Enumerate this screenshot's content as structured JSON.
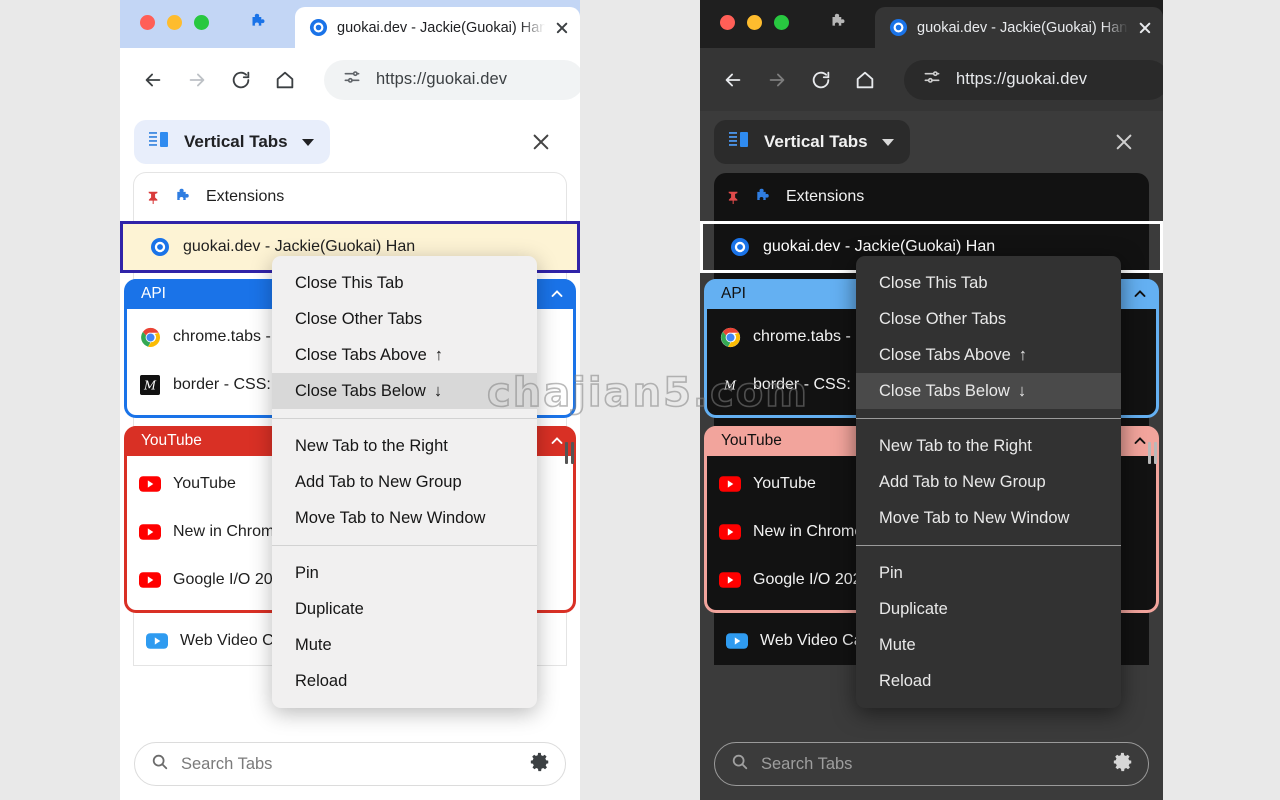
{
  "watermark": "chajian5.com",
  "browser": {
    "tab_title": "guokai.dev - Jackie(Guokai) Han",
    "url": "https://guokai.dev",
    "favicon": "guokai-favicon",
    "traffic_lights": [
      "close-red",
      "minimize-yellow",
      "maximize-green"
    ],
    "nav": {
      "back": "back-arrow-icon",
      "forward": "forward-arrow-icon",
      "reload": "reload-icon",
      "home": "home-icon",
      "site_settings": "site-settings-icon"
    },
    "extension_icon": "puzzle-piece-icon",
    "tab_close": "close-icon"
  },
  "panel": {
    "title": "Vertical Tabs",
    "title_icon": "vertical-tabs-icon",
    "dropdown_icon": "chevron-down-icon",
    "close_icon": "close-icon",
    "pinned_row": {
      "pin_icon": "pin-icon",
      "favicon": "puzzle-piece-icon",
      "label": "Extensions"
    },
    "selected_row": {
      "favicon": "guokai-favicon",
      "label": "guokai.dev - Jackie(Guokai) Han"
    },
    "groups": [
      {
        "name": "API",
        "color": "#1a73e8",
        "color_dark": "#64b0f2",
        "collapse_icon": "chevron-up-icon",
        "tabs": [
          {
            "favicon": "chrome-icon",
            "label": "chrome.tabs - Chrome Developers"
          },
          {
            "favicon": "mdn-icon",
            "label": "border - CSS: Cascading Style Sheets"
          }
        ]
      },
      {
        "name": "YouTube",
        "color": "#d93025",
        "color_dark": "#f2a49c",
        "collapse_icon": "chevron-up-icon",
        "tabs": [
          {
            "favicon": "youtube-icon",
            "label": "YouTube"
          },
          {
            "favicon": "youtube-icon",
            "label": "New in Chrome 114"
          },
          {
            "favicon": "youtube-icon",
            "label": "Google I/O 2023"
          }
        ]
      }
    ],
    "ungrouped": [
      {
        "favicon": "web-video-icon",
        "label": "Web Video Caster"
      }
    ],
    "search": {
      "placeholder": "Search Tabs",
      "search_icon": "search-icon",
      "settings_icon": "gear-icon"
    },
    "resize_handle": "resize-grip-icon"
  },
  "context_menu": {
    "highlighted": "Close Tabs Below ↓",
    "sections": [
      [
        {
          "label": "Close This Tab"
        },
        {
          "label": "Close Other Tabs"
        },
        {
          "label": "Close Tabs Above",
          "suffix": "↑"
        },
        {
          "label": "Close Tabs Below",
          "suffix": "↓"
        }
      ],
      [
        {
          "label": "New Tab to the Right"
        },
        {
          "label": "Add Tab to New Group"
        },
        {
          "label": "Move Tab to New Window"
        }
      ],
      [
        {
          "label": "Pin"
        },
        {
          "label": "Duplicate"
        },
        {
          "label": "Mute"
        },
        {
          "label": "Reload"
        }
      ]
    ]
  }
}
